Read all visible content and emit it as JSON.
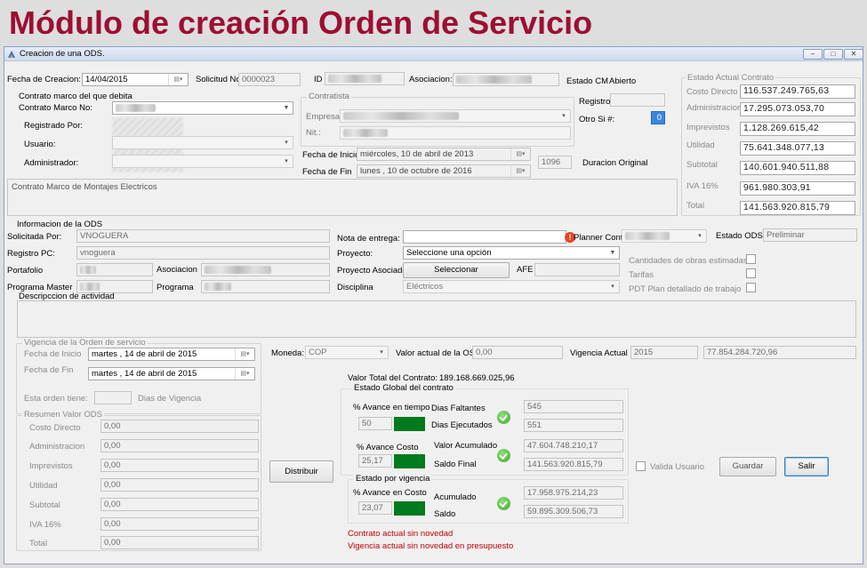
{
  "slide_title": "Módulo de creación Orden de Servicio",
  "window": {
    "title": "Creacion de una ODS.",
    "controls": [
      "minimize-icon",
      "maximize-icon",
      "close-icon"
    ]
  },
  "header": {
    "fecha_creacion_label": "Fecha de Creacion:",
    "fecha_creacion_value": "14/04/2015",
    "solicitud_label": "Solicitud No",
    "solicitud_value": "0000023",
    "id_label": "ID",
    "asociacion_label": "Asociacion:",
    "estado_cm_label": "Estado CM",
    "estado_cm_value": "Abierto"
  },
  "contrato_marco": {
    "section_label": "Contrato marco del que debita",
    "contrato_no_label": "Contrato Marco No:",
    "registrado_label": "Registrado Por:",
    "usuario_label": "Usuario:",
    "administrador_label": "Administrador:"
  },
  "contratista": {
    "section_label": "Contratista",
    "empresa_label": "Empresa:",
    "nit_label": "Nit.:",
    "registro_label": "Registro",
    "otro_si_label": "Otro Si #:",
    "otro_si_value": "0"
  },
  "fechas": {
    "inicio_label": "Fecha de Inicio",
    "inicio_value": "miércoles, 10 de     abril     de 2013",
    "fin_label": "Fecha de Fin",
    "fin_value": "lunes   , 10 de  octubre  de 2016",
    "duracion_value": "1096",
    "duracion_label": "Duracion Original"
  },
  "descripcion_contrato": "Contrato Marco de Montajes Electricos",
  "estado_actual": {
    "section_label": "Estado Actual Contrato",
    "items": [
      {
        "label": "Costo Directo",
        "value": "116.537.249.765,63"
      },
      {
        "label": "Administracion",
        "value": "17.295.073.053,70"
      },
      {
        "label": "Imprevistos",
        "value": "1.128.269.615,42"
      },
      {
        "label": "Utilidad",
        "value": "75.641.348.077,13"
      },
      {
        "label": "Subtotal",
        "value": "140.601.940.511,88"
      },
      {
        "label": "IVA 16%",
        "value": "961.980.303,91"
      },
      {
        "label": "Total",
        "value": "141.563.920.815,79"
      }
    ]
  },
  "ods": {
    "section_label": "Informacion de la ODS",
    "solicitada_label": "Solicitada Por:",
    "solicitada_value": "VNOGUERA",
    "registro_pc_label": "Registro PC:",
    "registro_pc_value": "vnoguera",
    "portafolio_label": "Portafolio",
    "asociacion_label": "Asociacion",
    "programa_master_label": "Programa Master",
    "programa_label": "Programa",
    "nota_entrega_label": "Nota de entrega:",
    "planner_label": "Planner Control",
    "estado_ods_label": "Estado ODS",
    "estado_ods_value": "Preliminar",
    "proyecto_label": "Proyecto:",
    "proyecto_value": "Seleccione una opción",
    "proyecto_asociado_label": "Proyecto Asociado",
    "seleccionar_label": "Seleccionar",
    "afe_label": "AFE",
    "disciplina_label": "Disciplina",
    "disciplina_value": "Eléctricos",
    "cantidades_label": "Cantidades de obras estimadas",
    "tarifas_label": "Tarifas",
    "pdt_label": "PDT Plan detallado de trabajo",
    "descripcion_label": "Descripccion de actividad"
  },
  "vigencia": {
    "section_label": "Vigencia de la Orden de servicio",
    "inicio_label": "Fecha de Inicio",
    "inicio_value": "martes  , 14 de     abril     de 2015",
    "fin_label": "Fecha de Fin",
    "fin_value": "martes  , 14 de     abril     de 2015",
    "tiene_label": "Esta orden tiene:",
    "dias_label": "Dias de Vigencia"
  },
  "resumen": {
    "section_label": "Resumen Valor ODS",
    "items": [
      {
        "label": "Costo Directo",
        "value": "0,00"
      },
      {
        "label": "Administracion",
        "value": "0,00"
      },
      {
        "label": "Imprevistos",
        "value": "0,00"
      },
      {
        "label": "Utilidad",
        "value": "0,00"
      },
      {
        "label": "Subtotal",
        "value": "0,00"
      },
      {
        "label": "IVA 16%",
        "value": "0,00"
      },
      {
        "label": "Total",
        "value": "0,00"
      }
    ]
  },
  "moneda": {
    "label": "Moneda:",
    "value": "COP",
    "valor_actual_label": "Valor actual de la OS",
    "valor_actual_value": "0,00",
    "vigencia_actual_label": "Vigencia Actual",
    "vigencia_year": "2015",
    "vigencia_value": "77.854.284.720,96"
  },
  "distribuir_label": "Distribuir",
  "valor_total": {
    "label": "Valor Total del Contrato:",
    "value": "189.168.669.025,96"
  },
  "estado_global": {
    "section_label": "Estado Global del contrato",
    "avance_tiempo_label": "% Avance en tiempo",
    "avance_tiempo_value": "50",
    "dias_faltantes_label": "Dias Faltantes",
    "dias_faltantes_value": "545",
    "dias_ejecutados_label": "Dias Ejecutados",
    "dias_ejecutados_value": "551",
    "avance_costo_label": "% Avance Costo",
    "avance_costo_value": "25,17",
    "valor_acumulado_label": "Valor Acumulado",
    "valor_acumulado_value": "47.604.748.210,17",
    "saldo_final_label": "Saldo Final",
    "saldo_final_value": "141.563.920.815,79"
  },
  "estado_vigencia": {
    "section_label": "Estado por vigencia",
    "avance_costo_label": "% Avance en Costo",
    "avance_costo_value": "23,07",
    "acumulado_label": "Acumulado",
    "acumulado_value": "17.958.975.214,23",
    "saldo_label": "Saldo",
    "saldo_value": "59.895.309.506,73"
  },
  "mensajes": {
    "contrato": "Contrato actual sin novedad",
    "vigencia": "Vigencia actual sin novedad en presupuesto"
  },
  "acciones": {
    "valida_usuario_label": "Valida Usuario",
    "guardar_label": "Guardar",
    "salir_label": "Salir"
  }
}
